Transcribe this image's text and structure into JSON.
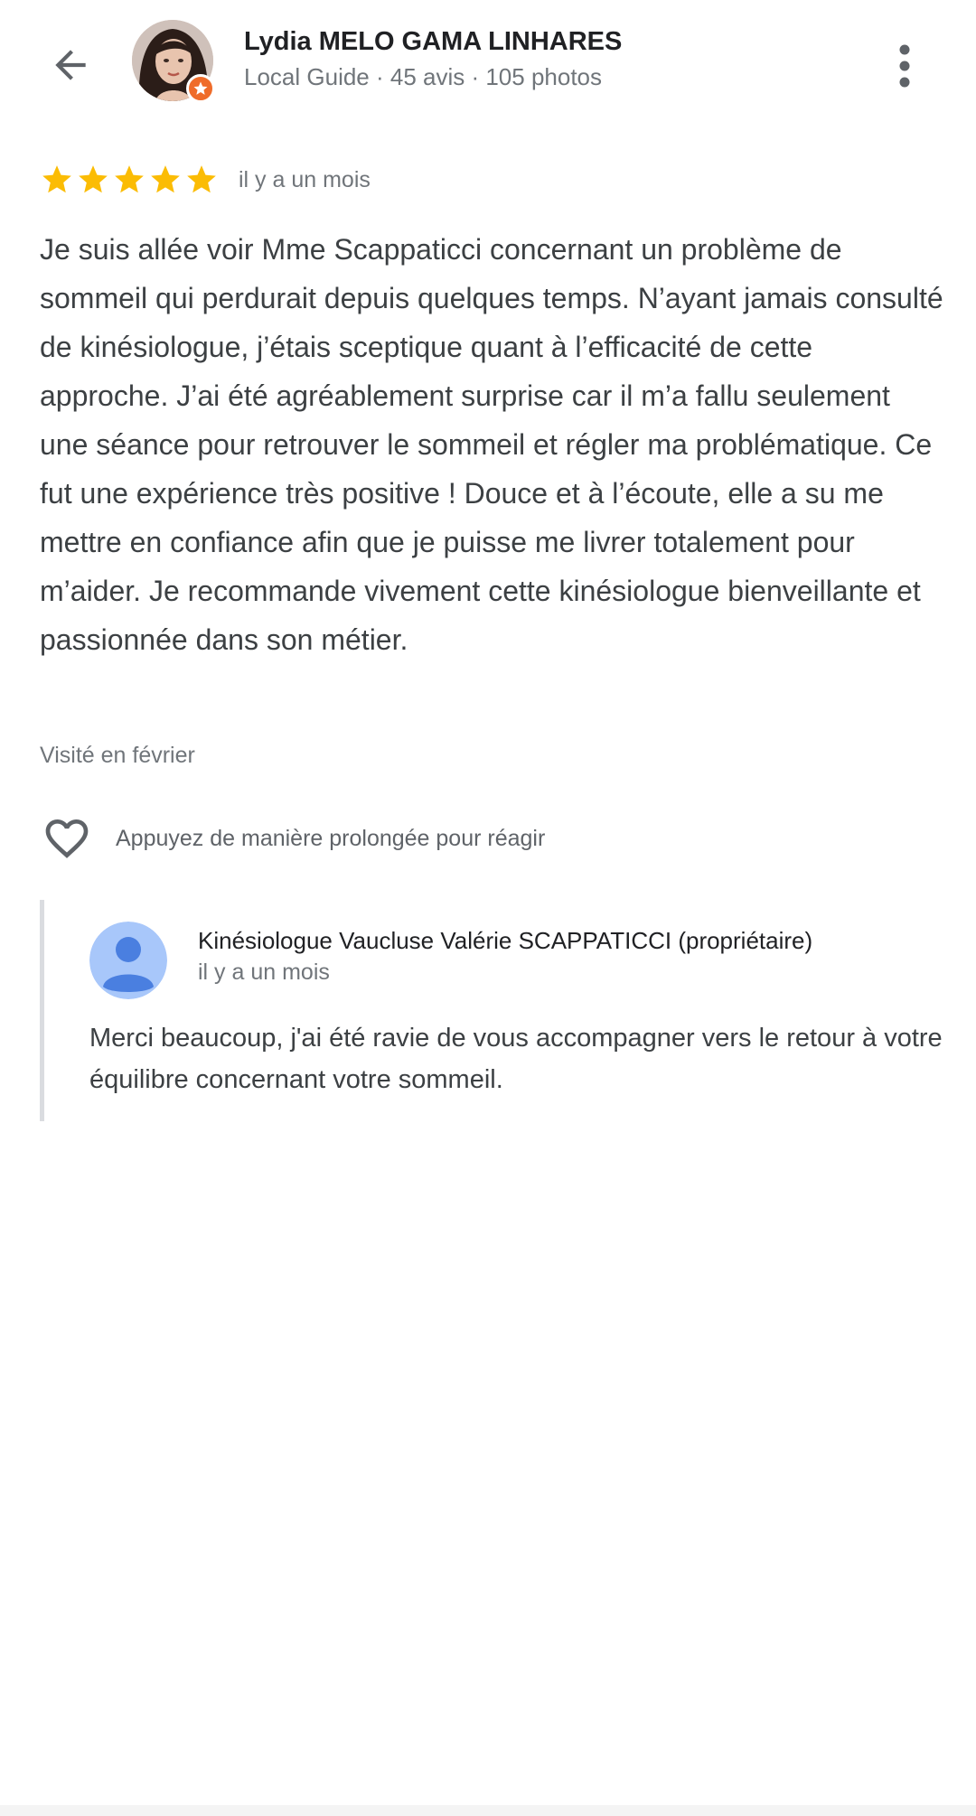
{
  "header": {
    "reviewer_name": "Lydia MELO GAMA LINHARES",
    "reviewer_meta": "Local Guide · 45 avis · 105 photos",
    "back_icon": "arrow-left-icon",
    "more_icon": "more-vertical-icon",
    "badge_icon": "local-guide-star-icon"
  },
  "review": {
    "rating": 5,
    "rating_max": 5,
    "time": "il y a un mois",
    "text": "Je suis allée voir Mme Scappaticci concernant un problème de sommeil qui perdurait depuis quelques temps. N’ayant jamais consulté de kinésiologue, j’étais sceptique quant à l’efficacité de cette approche. J’ai été agréablement surprise car il m’a fallu seulement une séance pour retrouver le sommeil et régler ma problématique. Ce fut une expérience très positive ! Douce et à l’écoute, elle a su me mettre en confiance afin que je puisse me livrer totalement pour m’aider. Je recommande vivement cette kinésiologue bienveillante et passionnée dans son métier.",
    "visited": "Visité en février",
    "react_label": "Appuyez de manière prolongée pour réagir",
    "react_icon": "heart-outline-icon"
  },
  "owner_reply": {
    "name": "Kinésiologue Vaucluse Valérie SCAPPATICCI (propriétaire)",
    "time": "il y a un mois",
    "text": "Merci beaucoup, j'ai été ravie de vous accompagner vers le retour à votre équilibre concernant votre sommeil.",
    "avatar_icon": "default-person-avatar-icon"
  },
  "colors": {
    "star": "#fbbc04",
    "badge": "#ef6c2a",
    "text_primary": "#202124",
    "text_secondary": "#70757a",
    "reply_border": "#dadce0",
    "avatar_bg": "#a8c7fa",
    "avatar_person": "#4a7fe0"
  }
}
